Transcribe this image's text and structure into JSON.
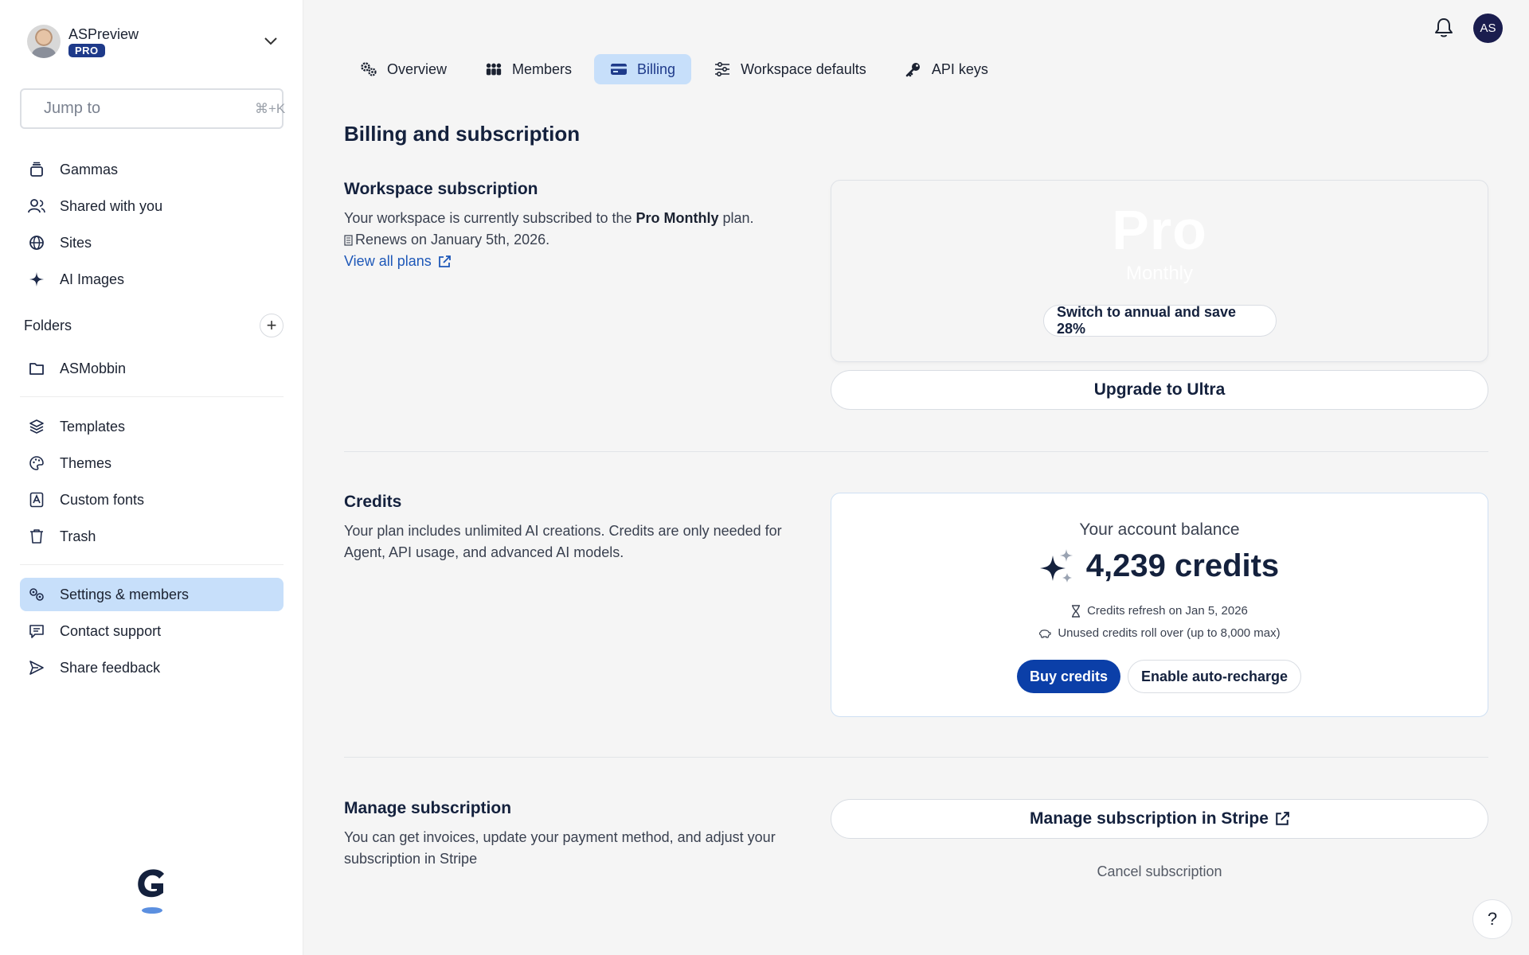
{
  "workspace": {
    "name": "ASPreview",
    "badge": "PRO"
  },
  "search": {
    "placeholder": "Jump to",
    "shortcut": "⌘+K"
  },
  "sidebar": {
    "primary": [
      {
        "label": "Gammas",
        "icon": "stack-icon"
      },
      {
        "label": "Shared with you",
        "icon": "users-icon"
      },
      {
        "label": "Sites",
        "icon": "globe-icon"
      },
      {
        "label": "AI Images",
        "icon": "sparkle-icon"
      }
    ],
    "folders_label": "Folders",
    "folders": [
      {
        "label": "ASMobbin",
        "icon": "folder-icon"
      }
    ],
    "secondary": [
      {
        "label": "Templates",
        "icon": "layers-icon"
      },
      {
        "label": "Themes",
        "icon": "palette-icon"
      },
      {
        "label": "Custom fonts",
        "icon": "font-icon"
      },
      {
        "label": "Trash",
        "icon": "trash-icon"
      }
    ],
    "tertiary": [
      {
        "label": "Settings & members",
        "icon": "settings-icon",
        "active": true
      },
      {
        "label": "Contact support",
        "icon": "chat-icon"
      },
      {
        "label": "Share feedback",
        "icon": "send-icon"
      }
    ]
  },
  "user": {
    "initials": "AS"
  },
  "tabs": [
    {
      "label": "Overview",
      "icon": "gears-icon"
    },
    {
      "label": "Members",
      "icon": "members-icon"
    },
    {
      "label": "Billing",
      "icon": "card-icon",
      "active": true
    },
    {
      "label": "Workspace defaults",
      "icon": "sliders-icon"
    },
    {
      "label": "API keys",
      "icon": "key-icon"
    }
  ],
  "page": {
    "title": "Billing and subscription"
  },
  "subscription": {
    "title": "Workspace subscription",
    "text_prefix": "Your workspace is currently subscribed to the ",
    "plan_name": "Pro Monthly",
    "text_suffix": " plan.",
    "renews": "Renews on January 5th, 2026.",
    "view_plans": "View all plans",
    "card_plan": "Pro",
    "card_period": "Monthly",
    "switch_label": "Switch to annual and save 28%",
    "upgrade_label": "Upgrade to Ultra"
  },
  "credits": {
    "title": "Credits",
    "text": "Your plan includes unlimited AI creations. Credits are only needed for Agent, API usage, and advanced AI models.",
    "balance_label": "Your account balance",
    "balance": "4,239 credits",
    "refresh": "Credits refresh on Jan 5, 2026",
    "rollover": "Unused credits roll over (up to 8,000 max)",
    "buy_label": "Buy credits",
    "auto_label": "Enable auto-recharge"
  },
  "manage": {
    "title": "Manage subscription",
    "text": "You can get invoices, update your payment method, and adjust your subscription in Stripe",
    "stripe_label": "Manage subscription in Stripe",
    "cancel_label": "Cancel subscription"
  },
  "colors": {
    "accent": "#0b3fa8",
    "active_bg": "#c7dffa",
    "navy": "#14213d"
  }
}
